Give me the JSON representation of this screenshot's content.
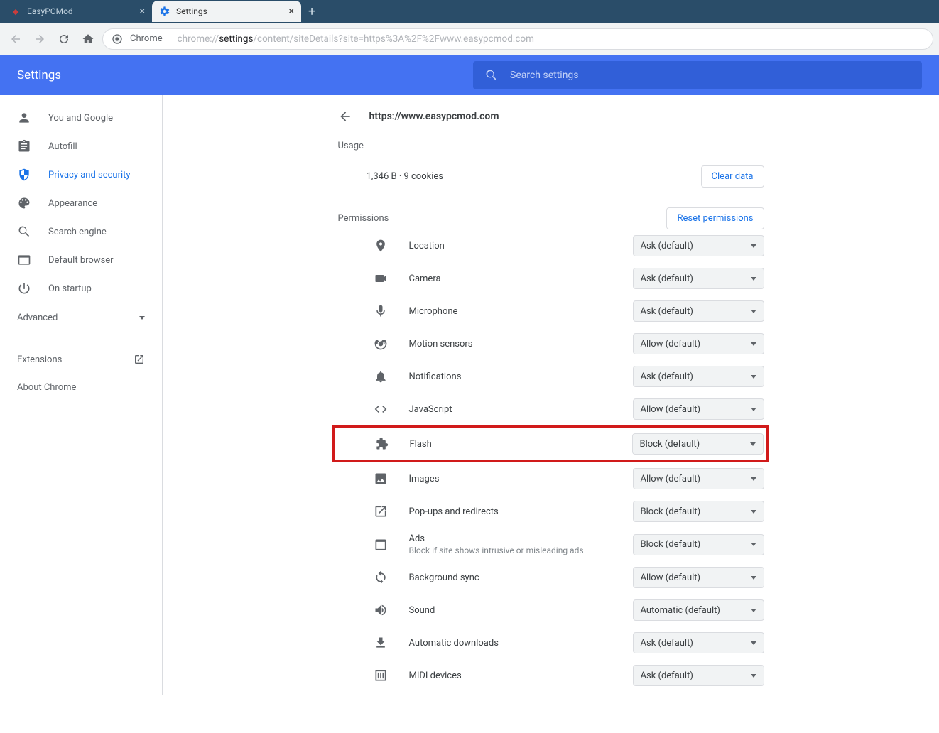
{
  "browser": {
    "tabs": [
      {
        "title": "EasyPCMod",
        "active": false
      },
      {
        "title": "Settings",
        "active": true
      }
    ],
    "omnibox_badge": "Chrome",
    "omnibox_prefix": "chrome://",
    "omnibox_bold": "settings",
    "omnibox_suffix": "/content/siteDetails?site=https%3A%2F%2Fwww.easypcmod.com"
  },
  "header": {
    "title": "Settings",
    "search_placeholder": "Search settings"
  },
  "sidebar": {
    "items": [
      {
        "label": "You and Google"
      },
      {
        "label": "Autofill"
      },
      {
        "label": "Privacy and security"
      },
      {
        "label": "Appearance"
      },
      {
        "label": "Search engine"
      },
      {
        "label": "Default browser"
      },
      {
        "label": "On startup"
      }
    ],
    "advanced": "Advanced",
    "extensions": "Extensions",
    "about": "About Chrome"
  },
  "page": {
    "site": "https://www.easypcmod.com",
    "usage_label": "Usage",
    "usage_text": "1,346 B · 9 cookies",
    "clear_data": "Clear data",
    "permissions_label": "Permissions",
    "reset": "Reset permissions"
  },
  "permissions": [
    {
      "name": "Location",
      "value": "Ask (default)"
    },
    {
      "name": "Camera",
      "value": "Ask (default)"
    },
    {
      "name": "Microphone",
      "value": "Ask (default)"
    },
    {
      "name": "Motion sensors",
      "value": "Allow (default)"
    },
    {
      "name": "Notifications",
      "value": "Ask (default)"
    },
    {
      "name": "JavaScript",
      "value": "Allow (default)"
    },
    {
      "name": "Flash",
      "value": "Block (default)",
      "highlighted": true
    },
    {
      "name": "Images",
      "value": "Allow (default)"
    },
    {
      "name": "Pop-ups and redirects",
      "value": "Block (default)"
    },
    {
      "name": "Ads",
      "sub": "Block if site shows intrusive or misleading ads",
      "value": "Block (default)"
    },
    {
      "name": "Background sync",
      "value": "Allow (default)"
    },
    {
      "name": "Sound",
      "value": "Automatic (default)"
    },
    {
      "name": "Automatic downloads",
      "value": "Ask (default)"
    },
    {
      "name": "MIDI devices",
      "value": "Ask (default)"
    }
  ]
}
